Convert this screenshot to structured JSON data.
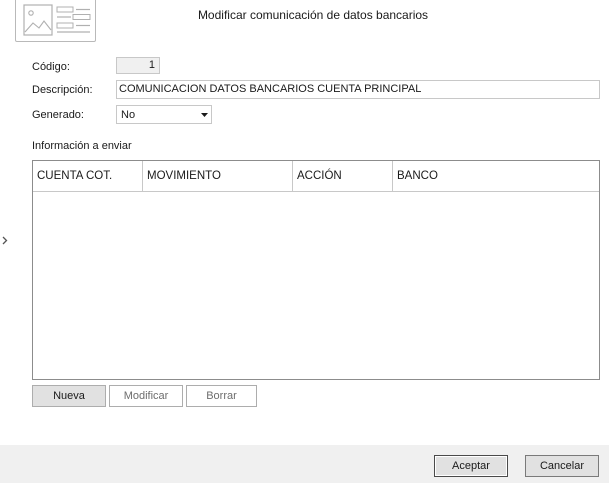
{
  "dialog": {
    "title": "Modificar comunicación de datos bancarios"
  },
  "form": {
    "codigo_label": "Código:",
    "codigo_value": "1",
    "descripcion_label": "Descripción:",
    "descripcion_value": "COMUNICACION DATOS BANCARIOS CUENTA PRINCIPAL",
    "generado_label": "Generado:",
    "generado_value": "No"
  },
  "section": {
    "title": "Información a enviar"
  },
  "grid": {
    "columns": [
      "CUENTA COT.",
      "MOVIMIENTO",
      "ACCIÓN",
      "BANCO"
    ],
    "rows": []
  },
  "grid_buttons": {
    "nueva": "Nueva",
    "modificar": "Modificar",
    "borrar": "Borrar"
  },
  "footer": {
    "aceptar": "Aceptar",
    "cancelar": "Cancelar"
  },
  "icons": {
    "document": "document-icon",
    "dropdown": "chevron-down-icon",
    "expand": "chevron-right-icon"
  },
  "colors": {
    "border": "#c8c8c8",
    "grid_border": "#8c8c8c",
    "footer_bg": "#f0f0f0",
    "button_bg": "#e1e1e1"
  }
}
